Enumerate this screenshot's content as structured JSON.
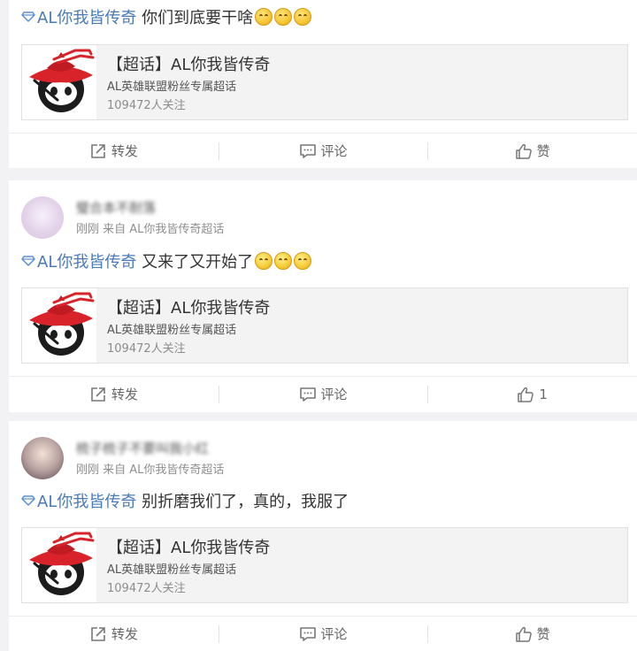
{
  "topic": {
    "title": "【超话】AL你我皆传奇",
    "description": "AL英雄联盟粉丝专属超话",
    "followers": "109472人关注",
    "link_text": "AL你我皆传奇"
  },
  "posts": [
    {
      "author": "",
      "meta": "",
      "text": "你们到底要干啥",
      "emoji": "smile-emoji",
      "emoji_count": 3,
      "actions": {
        "repost": "转发",
        "comment": "评论",
        "like": "赞"
      }
    },
    {
      "author": "璧合本不耐落",
      "meta": "刚刚 来自 AL你我皆传奇超话",
      "text": "又来了又开始了",
      "emoji": "thinking-emoji",
      "emoji_count": 3,
      "actions": {
        "repost": "转发",
        "comment": "评论",
        "like": "1"
      }
    },
    {
      "author": "梳子梳子不要叫我小红",
      "meta": "刚刚 来自 AL你我皆传奇超话",
      "text": "别折磨我们了，真的，我服了",
      "emoji": "",
      "emoji_count": 0,
      "actions": {
        "repost": "转发",
        "comment": "评论",
        "like": "赞"
      }
    }
  ],
  "colors": {
    "link": "#4a7bb8",
    "background": "#f2f2f5",
    "logo_red": "#d8232a"
  }
}
